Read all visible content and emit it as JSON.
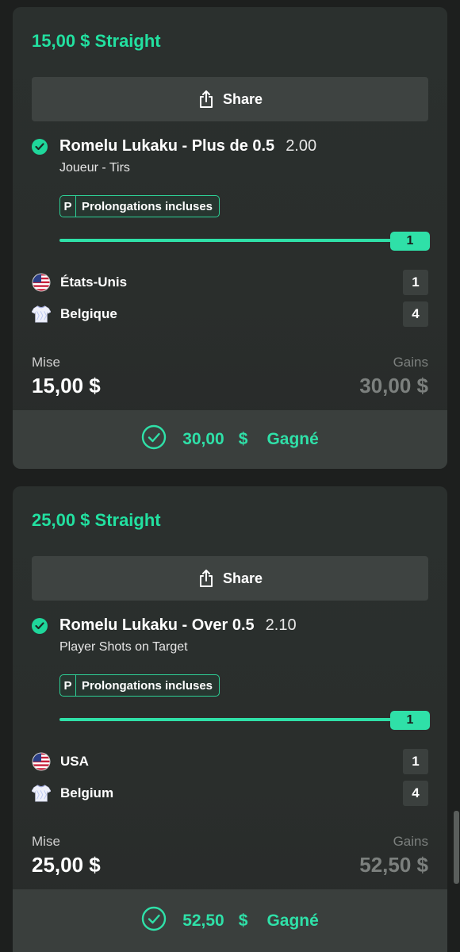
{
  "bets": [
    {
      "title": "15,00 $ Straight",
      "share_label": "Share",
      "selection": "Romelu Lukaku - Plus de 0.5",
      "odds": "2.00",
      "market": "Joueur - Tirs",
      "badge_p": "P",
      "badge_label": "Prolongations incluses",
      "progress_value": "1",
      "progress_fraction": 1.0,
      "teams": [
        {
          "name": "États-Unis",
          "score": "1",
          "icon": "usa-flag-icon"
        },
        {
          "name": "Belgique",
          "score": "4",
          "icon": "belgium-jersey-icon"
        }
      ],
      "stake_label": "Mise",
      "stake_value": "15,00 $",
      "gains_label": "Gains",
      "gains_value": "30,00 $",
      "result_amount": "30,00",
      "result_currency": "$",
      "result_status": "Gagné"
    },
    {
      "title": "25,00 $ Straight",
      "share_label": "Share",
      "selection": "Romelu Lukaku - Over 0.5",
      "odds": "2.10",
      "market": "Player Shots on Target",
      "badge_p": "P",
      "badge_label": "Prolongations incluses",
      "progress_value": "1",
      "progress_fraction": 1.0,
      "teams": [
        {
          "name": "USA",
          "score": "1",
          "icon": "usa-flag-icon"
        },
        {
          "name": "Belgium",
          "score": "4",
          "icon": "belgium-jersey-icon"
        }
      ],
      "stake_label": "Mise",
      "stake_value": "25,00 $",
      "gains_label": "Gains",
      "gains_value": "52,50 $",
      "result_amount": "52,50",
      "result_currency": "$",
      "result_status": "Gagné"
    }
  ],
  "colors": {
    "accent": "#2fe0a8",
    "title_green": "#22e0a0",
    "card_bg": "#2b302e",
    "page_bg": "#1d1f1e",
    "muted_text": "#7c807e"
  }
}
